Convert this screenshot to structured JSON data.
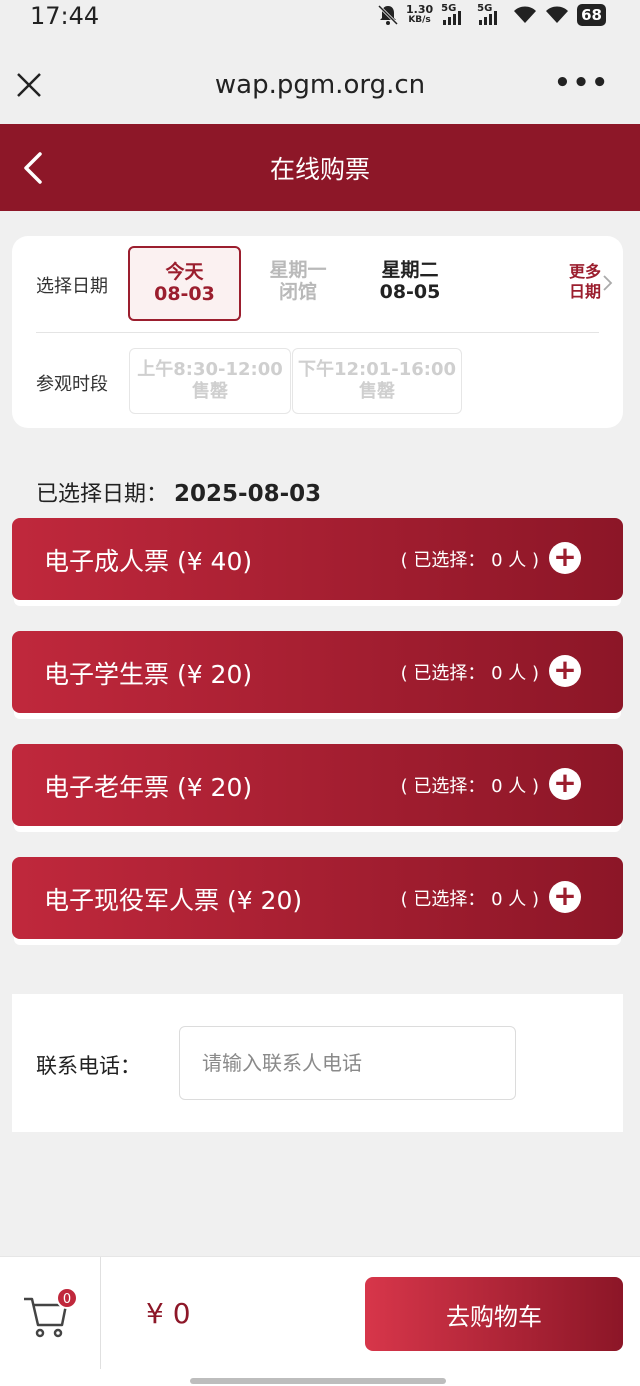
{
  "status_bar": {
    "time": "17:44",
    "net_speed_value": "1.30",
    "net_speed_unit": "KB/s",
    "sim1_label": "5G",
    "sim2_label": "5G",
    "battery": "68",
    "icons": [
      "mute-bell-icon",
      "signal-icon",
      "wifi-icon",
      "battery-icon"
    ]
  },
  "browser": {
    "url": "wap.pgm.org.cn",
    "more_label": "•••"
  },
  "header": {
    "title": "在线购票"
  },
  "date_selector": {
    "label": "选择日期",
    "options": [
      {
        "line1": "今天",
        "line2": "08-03",
        "state": "selected"
      },
      {
        "line1": "星期一",
        "line2": "闭馆",
        "state": "closed"
      },
      {
        "line1": "星期二",
        "line2": "08-05",
        "state": "available"
      }
    ],
    "more_line1": "更多",
    "more_line2": "日期"
  },
  "time_slots": {
    "label": "参观时段",
    "slots": [
      {
        "time": "上午8:30-12:00",
        "status": "售罄"
      },
      {
        "time": "下午12:01-16:00",
        "status": "售罄"
      }
    ]
  },
  "selected_date": {
    "label": "已选择日期：",
    "value": "2025-08-03"
  },
  "tickets": [
    {
      "name": "电子成人票 (¥ 40)",
      "count_text": "( 已选择： 0 人 )"
    },
    {
      "name": "电子学生票 (¥ 20)",
      "count_text": "( 已选择： 0 人 )"
    },
    {
      "name": "电子老年票 (¥ 20)",
      "count_text": "( 已选择： 0 人 )"
    },
    {
      "name": "电子现役军人票 (¥ 20)",
      "count_text": "( 已选择： 0 人 )"
    }
  ],
  "contact": {
    "label": "联系电话：",
    "placeholder": "请输入联系人电话",
    "value": ""
  },
  "footer": {
    "cart_count": "0",
    "total": "¥ 0",
    "checkout_label": "去购物车"
  },
  "colors": {
    "brand": "#8d1728",
    "accent": "#c0283c"
  }
}
